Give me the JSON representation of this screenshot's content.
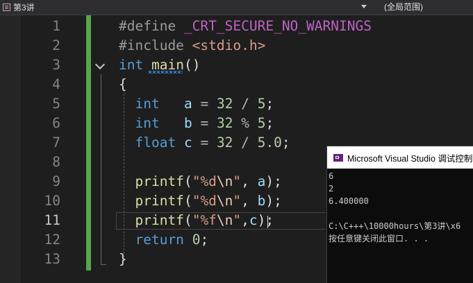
{
  "navbar": {
    "project_name": "第3讲",
    "scope": "(全局范围)"
  },
  "editor": {
    "current_line": 11,
    "lines": [
      {
        "n": "1"
      },
      {
        "n": "2"
      },
      {
        "n": "3"
      },
      {
        "n": "4"
      },
      {
        "n": "5"
      },
      {
        "n": "6"
      },
      {
        "n": "7"
      },
      {
        "n": "8"
      },
      {
        "n": "9"
      },
      {
        "n": "10"
      },
      {
        "n": "11"
      },
      {
        "n": "12"
      },
      {
        "n": "13"
      }
    ],
    "code": {
      "l1": {
        "directive": "#define",
        "macro": "_CRT_SECURE_NO_WARNINGS"
      },
      "l2": {
        "directive": "#include",
        "header": "<stdio.h>"
      },
      "l3": {
        "type": "int",
        "name": "main",
        "parens": "()"
      },
      "l4": {
        "brace": "{"
      },
      "l5": {
        "type": "int",
        "var": "a",
        "op1": "=",
        "n1": "32",
        "op2": "/",
        "n2": "5",
        "end": ";"
      },
      "l6": {
        "type": "int",
        "var": "b",
        "op1": "=",
        "n1": "32",
        "op2": "%",
        "n2": "5",
        "end": ";"
      },
      "l7": {
        "type": "float",
        "var": "c",
        "op1": "=",
        "n1": "32",
        "op2": "/",
        "n2": "5.0",
        "end": ";"
      },
      "l9": {
        "fn": "printf",
        "open": "(",
        "q1": "\"",
        "fmt": "%d",
        "esc": "\\n",
        "q2": "\"",
        "comma": ",",
        "arg": "a",
        "close": ");"
      },
      "l10": {
        "fn": "printf",
        "open": "(",
        "q1": "\"",
        "fmt": "%d",
        "esc": "\\n",
        "q2": "\"",
        "comma": ",",
        "arg": "b",
        "close": ");"
      },
      "l11": {
        "fn": "printf",
        "open": "(",
        "q1": "\"",
        "fmt": "%f",
        "esc": "\\n",
        "q2": "\"",
        "comma": ",",
        "arg": "c",
        "close": ");"
      },
      "l12": {
        "kw": "return",
        "val": "0",
        "end": ";"
      },
      "l13": {
        "brace": "}"
      }
    }
  },
  "console": {
    "title": "Microsoft Visual Studio 调试控制",
    "output": [
      "6",
      "2",
      "6.400000",
      "",
      "C:\\C+++\\10000hours\\第3讲\\x6",
      "按任意键关闭此窗口. . ."
    ]
  },
  "icons": [
    "project-icon",
    "dropdown-arrow-icon",
    "collapse-arrow-icon",
    "console-app-icon"
  ],
  "colors": {
    "keyword": "#569cd6",
    "function": "#dcdcaa",
    "identifier": "#9cdcfe",
    "number": "#b5cea8",
    "string": "#d69d85",
    "macro": "#bd63c5",
    "change_bar": "#57a64a"
  }
}
